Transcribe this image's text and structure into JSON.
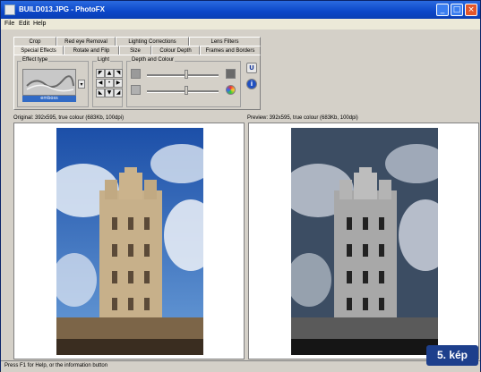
{
  "window": {
    "title": "BUILD013.JPG - PhotoFX"
  },
  "menu": [
    "File",
    "Edit",
    "Help"
  ],
  "tabs": {
    "row1": [
      "Crop",
      "Red eye Removal",
      "Lighting Corrections",
      "Lens Filters"
    ],
    "row2": [
      "Special Effects",
      "Rotate and Flip",
      "Size",
      "Colour Depth",
      "Frames and Borders"
    ]
  },
  "groups": {
    "effect_type": "Effect type",
    "light": "Light",
    "depth_colour": "Depth and Colour"
  },
  "effect": {
    "selected": "emboss"
  },
  "captions": {
    "original": "Original: 392x595, true colour (683Kb, 100dpi)",
    "preview": "Preview: 392x595, true colour (683Kb, 100dpi)"
  },
  "status": {
    "text": "Press F1 for Help, or the information button"
  },
  "badge": {
    "label": "5. kép"
  },
  "colors": {
    "titlebar": "#0b46c8",
    "chrome": "#d4d0c8",
    "badge": "#1d3f8c"
  }
}
